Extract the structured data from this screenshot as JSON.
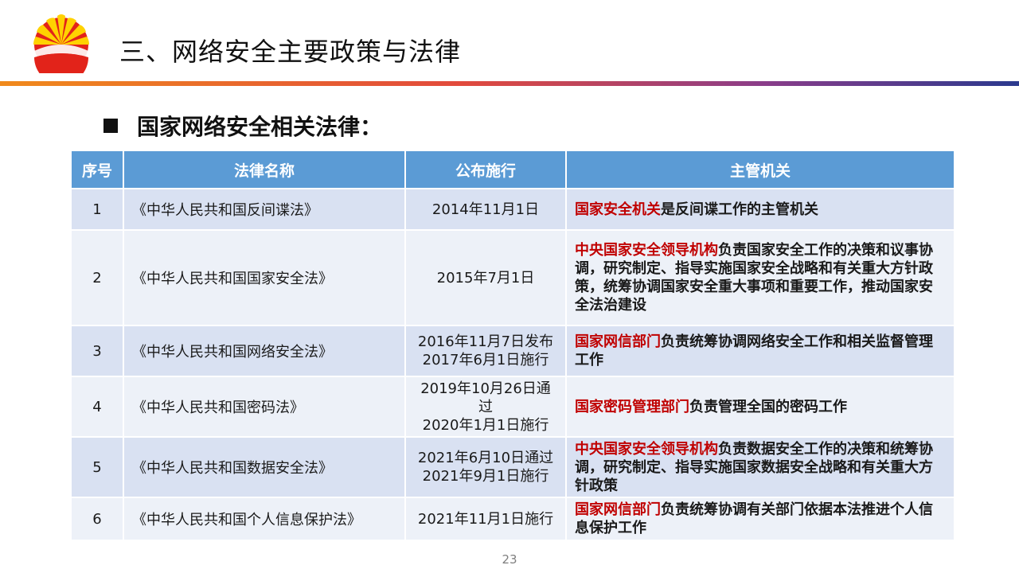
{
  "slide": {
    "title": "三、网络安全主要政策与法律",
    "section_heading": "国家网络安全相关法律：",
    "page_number": "23"
  },
  "colors": {
    "header_bg": "#5b9bd5",
    "row_odd_bg": "#d9e1f2",
    "row_even_bg": "#edf1f8",
    "highlight_red": "#c00000"
  },
  "table": {
    "headers": [
      "序号",
      "法律名称",
      "公布施行",
      "主管机关"
    ],
    "rows": [
      {
        "no": "1",
        "name": "《中华人民共和国反间谍法》",
        "date_line1": "2014年11月1日",
        "date_line2": "",
        "authority_highlight": "国家安全机关",
        "authority_text": "是反间谍工作的主管机关"
      },
      {
        "no": "2",
        "name": "《中华人民共和国国家安全法》",
        "date_line1": "2015年7月1日",
        "date_line2": "",
        "authority_highlight": "中央国家安全领导机构",
        "authority_text": "负责国家安全工作的决策和议事协调，研究制定、指导实施国家安全战略和有关重大方针政策，统筹协调国家安全重大事项和重要工作，推动国家安全法治建设"
      },
      {
        "no": "3",
        "name": "《中华人民共和国网络安全法》",
        "date_line1": "2016年11月7日发布",
        "date_line2": "2017年6月1日施行",
        "authority_highlight": "国家网信部门",
        "authority_text": "负责统筹协调网络安全工作和相关监督管理工作"
      },
      {
        "no": "4",
        "name": "《中华人民共和国密码法》",
        "date_line1": "2019年10月26日通过",
        "date_line2": "2020年1月1日施行",
        "authority_highlight": "国家密码管理部门",
        "authority_text": "负责管理全国的密码工作"
      },
      {
        "no": "5",
        "name": "《中华人民共和国数据安全法》",
        "date_line1": "2021年6月10日通过",
        "date_line2": "2021年9月1日施行",
        "authority_highlight": "中央国家安全领导机构",
        "authority_text": "负责数据安全工作的决策和统筹协调，研究制定、指导实施国家数据安全战略和有关重大方针政策"
      },
      {
        "no": "6",
        "name": "《中华人民共和国个人信息保护法》",
        "date_line1": "2021年11月1日施行",
        "date_line2": "",
        "authority_highlight": "国家网信部门",
        "authority_text": "负责统筹协调有关部门依据本法推进个人信息保护工作"
      }
    ]
  }
}
